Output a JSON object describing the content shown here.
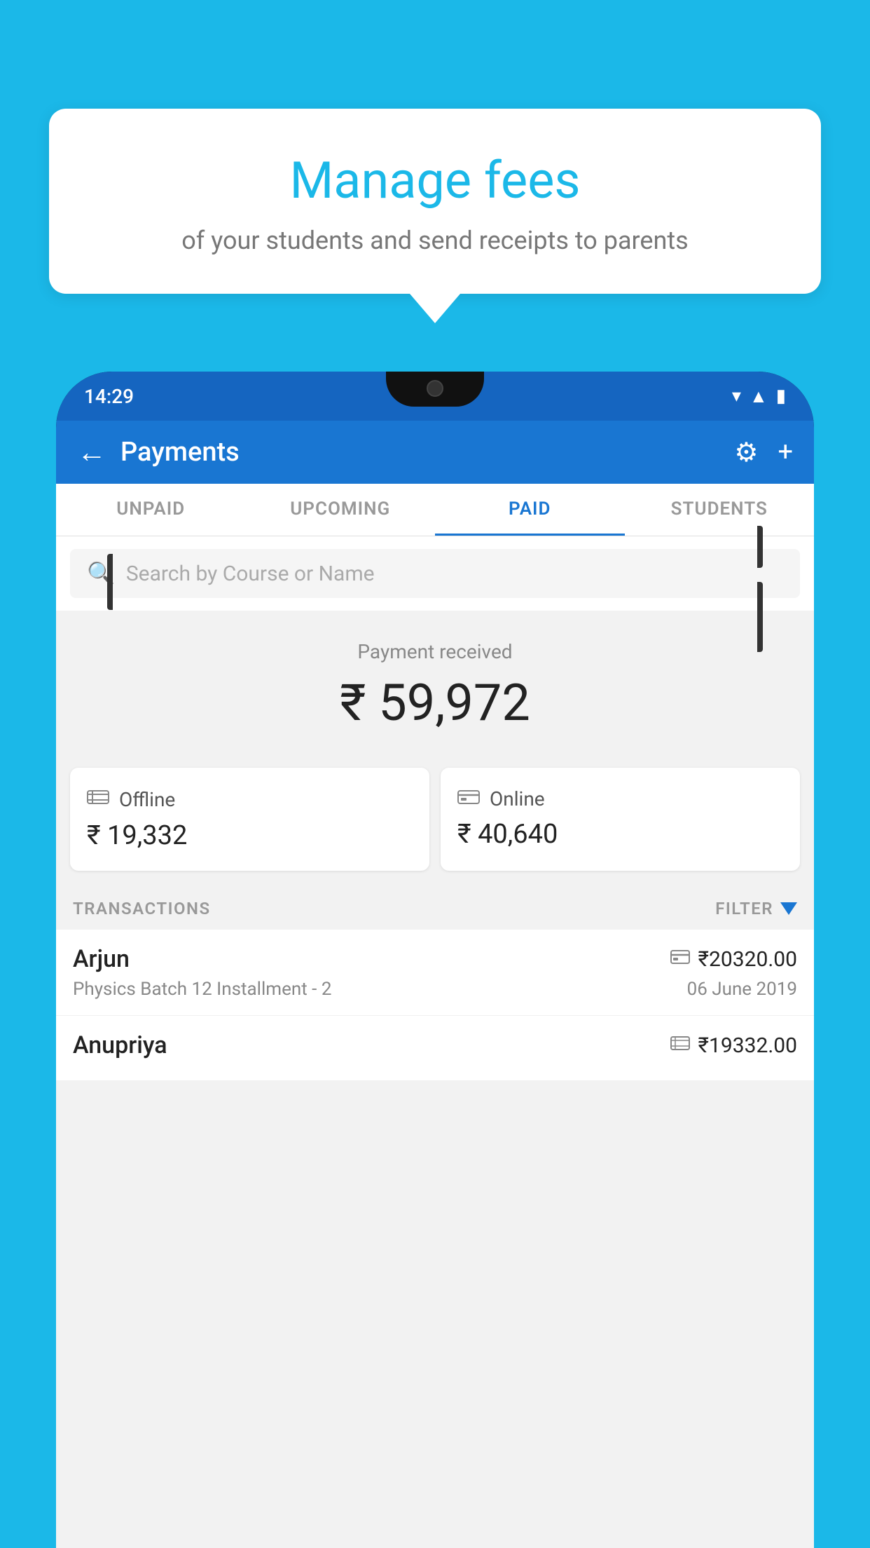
{
  "page": {
    "background_color": "#1BB8E8"
  },
  "tooltip": {
    "title": "Manage fees",
    "subtitle": "of your students and send receipts to parents"
  },
  "status_bar": {
    "time": "14:29",
    "wifi_icon": "▲",
    "signal_icon": "▲",
    "battery_icon": "▮"
  },
  "header": {
    "back_label": "←",
    "title": "Payments",
    "settings_icon": "⚙",
    "add_icon": "+"
  },
  "tabs": [
    {
      "label": "UNPAID",
      "active": false
    },
    {
      "label": "UPCOMING",
      "active": false
    },
    {
      "label": "PAID",
      "active": true
    },
    {
      "label": "STUDENTS",
      "active": false
    }
  ],
  "search": {
    "placeholder": "Search by Course or Name"
  },
  "payment_summary": {
    "label": "Payment received",
    "amount": "₹ 59,972",
    "offline": {
      "icon": "💳",
      "label": "Offline",
      "amount": "₹ 19,332"
    },
    "online": {
      "icon": "💳",
      "label": "Online",
      "amount": "₹ 40,640"
    }
  },
  "transactions": {
    "section_label": "TRANSACTIONS",
    "filter_label": "FILTER",
    "rows": [
      {
        "name": "Arjun",
        "amount": "₹20320.00",
        "course": "Physics Batch 12 Installment - 2",
        "date": "06 June 2019",
        "icon": "card"
      },
      {
        "name": "Anupriya",
        "amount": "₹19332.00",
        "course": "",
        "date": "",
        "icon": "cash"
      }
    ]
  }
}
